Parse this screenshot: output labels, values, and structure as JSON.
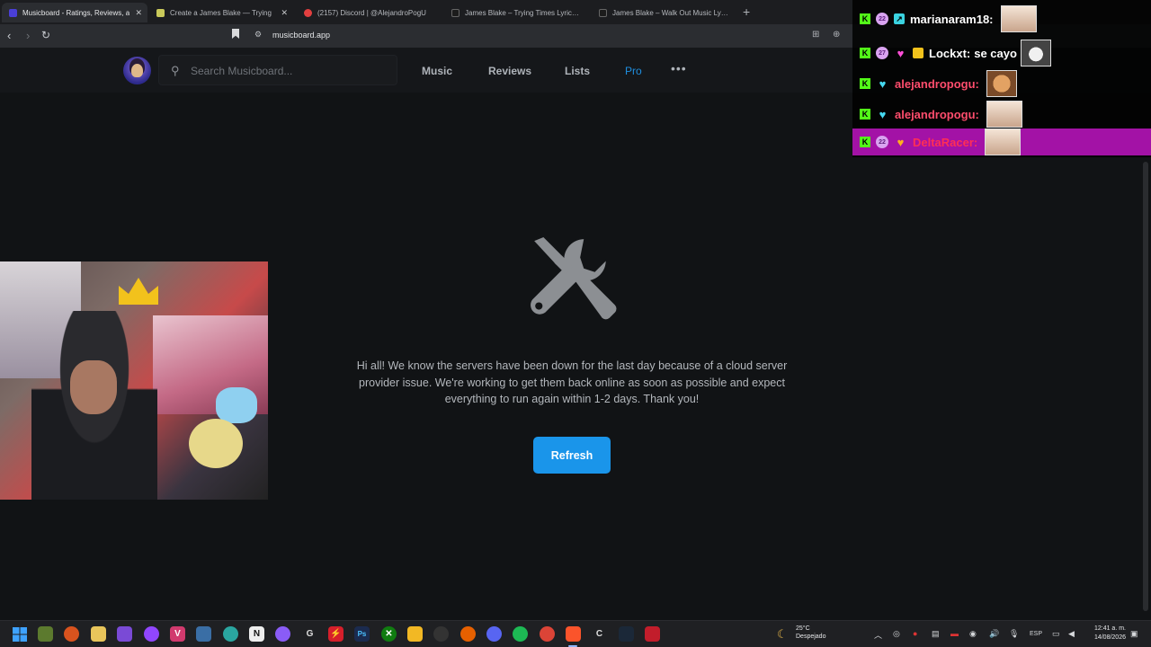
{
  "browser": {
    "tabs": [
      {
        "label": "Musicboard - Ratings, Reviews, a",
        "active": true,
        "favicon_color": "#4a3fd6"
      },
      {
        "label": "Create a James Blake — Trying",
        "active": false,
        "favicon_color": "#c9c95a"
      },
      {
        "label": "(2157) Discord | @AlejandroPogU",
        "active": false,
        "favicon_color": "#e23f3f"
      },
      {
        "label": "James Blake – Trying Times Lyrics | Ge",
        "active": false,
        "favicon_color": "#1c1c1c"
      },
      {
        "label": "James Blake – Walk Out Music Lyrics",
        "active": false,
        "favicon_color": "#1c1c1c"
      }
    ],
    "new_tab": "+",
    "url": "musicboard.app"
  },
  "header": {
    "search_placeholder": "Search Musicboard...",
    "nav": {
      "music": "Music",
      "reviews": "Reviews",
      "lists": "Lists",
      "pro": "Pro",
      "more": "•••"
    }
  },
  "main": {
    "message": "Hi all! We know the servers have been down for the last day because of a cloud server provider issue. We're working to get them back online as soon as possible and expect everything to run again within 1-2 days. Thank you!",
    "refresh_label": "Refresh"
  },
  "chat": [
    {
      "badges": [
        "kick",
        "lvl-22",
        "sub"
      ],
      "level": "22",
      "user": "marianaram18:",
      "message": "",
      "user_color": "#ffffff",
      "highlight": false,
      "emote": "face"
    },
    {
      "badges": [
        "kick",
        "lvl-27",
        "heart",
        "gift"
      ],
      "level": "27",
      "user": "Lockxt:",
      "message": "se cayo",
      "user_color": "#ffffff",
      "highlight": false,
      "emote": "cat"
    },
    {
      "badges": [
        "kick",
        "heart"
      ],
      "level": "",
      "user": "alejandropogu:",
      "message": "",
      "user_color": "#ff4d6d",
      "highlight": false,
      "emote": "dog"
    },
    {
      "badges": [
        "kick",
        "heart"
      ],
      "level": "",
      "user": "alejandropogu:",
      "message": "",
      "user_color": "#ff4d6d",
      "highlight": false,
      "emote": "face"
    },
    {
      "badges": [
        "kick",
        "lvl-22",
        "heart"
      ],
      "level": "22",
      "user": "DeltaRacer:",
      "message": "",
      "user_color": "#ff2e55",
      "highlight": true,
      "emote": "face"
    }
  ],
  "taskbar": {
    "weather": {
      "temp": "25°C",
      "condition": "Despejado"
    },
    "lang": "ESP",
    "time": "12:41 a. m.",
    "date": "14/08/2026"
  }
}
